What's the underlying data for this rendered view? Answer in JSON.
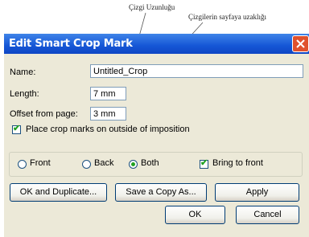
{
  "annotations": {
    "callout_length": "Çizgi Uzunluğu",
    "callout_offset": "Çizgilerin sayfaya uzaklığı"
  },
  "dialog": {
    "title": "Edit Smart Crop Mark",
    "fields": {
      "name_label": "Name:",
      "name_value": "Untitled_Crop",
      "length_label": "Length:",
      "length_value": "7 mm",
      "offset_label": "Offset from page:",
      "offset_value": "3 mm"
    },
    "place_outside": {
      "label": "Place crop marks on outside of imposition",
      "checked": true
    },
    "layer": {
      "options": [
        "Front",
        "Back",
        "Both"
      ],
      "selected": "Both",
      "bring_to_front": {
        "label": "Bring to front",
        "checked": true
      }
    },
    "buttons": {
      "ok_duplicate": "OK and Duplicate...",
      "save_copy": "Save a Copy As...",
      "apply": "Apply",
      "ok": "OK",
      "cancel": "Cancel"
    }
  },
  "colors": {
    "titlebar": "#1556d6",
    "close": "#e0512d",
    "check": "#21a121",
    "face": "#ece9d8"
  }
}
